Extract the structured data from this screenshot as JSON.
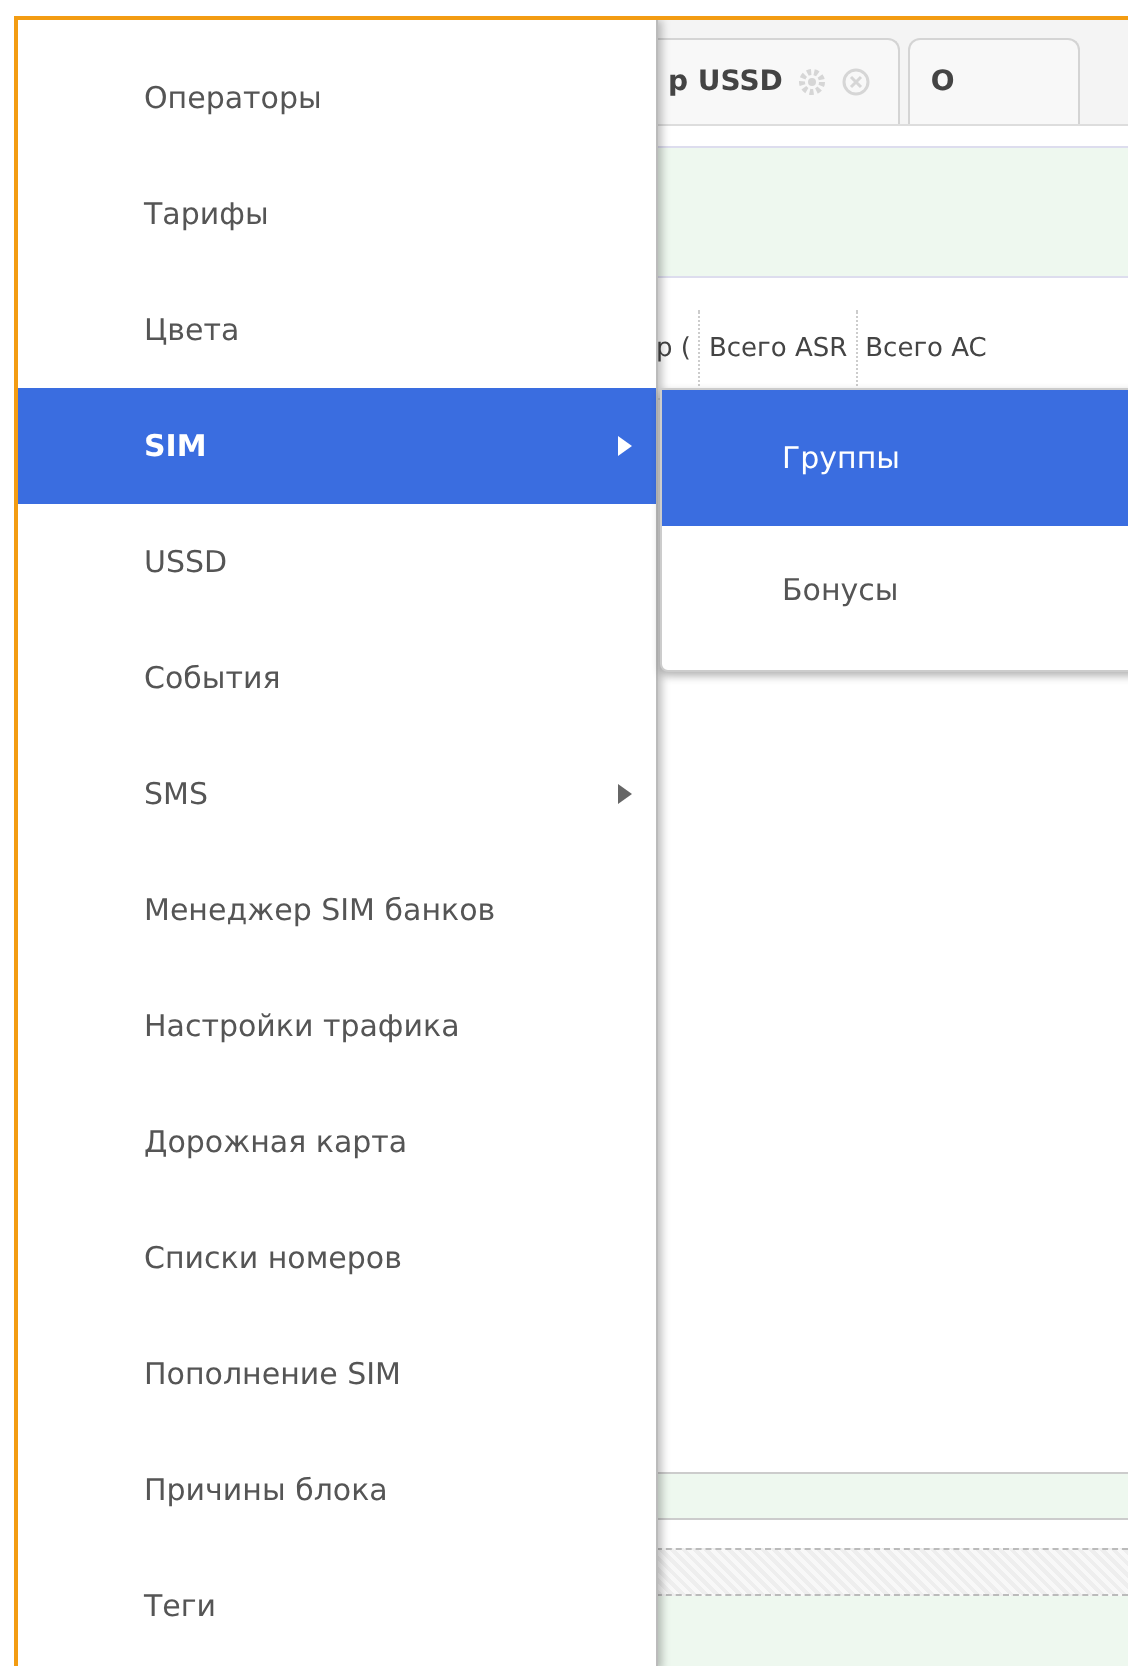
{
  "tabs": [
    {
      "label": "р USSD",
      "kind": "closable"
    },
    {
      "label": "О",
      "kind": "plain"
    }
  ],
  "grid": {
    "columns": [
      "р (",
      "Всего ASR",
      "Всего AC"
    ]
  },
  "menu": {
    "items": [
      {
        "label": "Операторы",
        "selected": false,
        "has_submenu": false
      },
      {
        "label": "Тарифы",
        "selected": false,
        "has_submenu": false
      },
      {
        "label": "Цвета",
        "selected": false,
        "has_submenu": false
      },
      {
        "label": "SIM",
        "selected": true,
        "has_submenu": true
      },
      {
        "label": "USSD",
        "selected": false,
        "has_submenu": false
      },
      {
        "label": "События",
        "selected": false,
        "has_submenu": false
      },
      {
        "label": "SMS",
        "selected": false,
        "has_submenu": true
      },
      {
        "label": "Менеджер SIM банков",
        "selected": false,
        "has_submenu": false
      },
      {
        "label": "Настройки трафика",
        "selected": false,
        "has_submenu": false
      },
      {
        "label": "Дорожная карта",
        "selected": false,
        "has_submenu": false
      },
      {
        "label": "Списки номеров",
        "selected": false,
        "has_submenu": false
      },
      {
        "label": "Пополнение SIM",
        "selected": false,
        "has_submenu": false
      },
      {
        "label": "Причины блока",
        "selected": false,
        "has_submenu": false
      },
      {
        "label": "Теги",
        "selected": false,
        "has_submenu": false
      }
    ]
  },
  "submenu": {
    "items": [
      {
        "label": "Группы",
        "selected": true
      },
      {
        "label": "Бонусы",
        "selected": false
      }
    ]
  }
}
